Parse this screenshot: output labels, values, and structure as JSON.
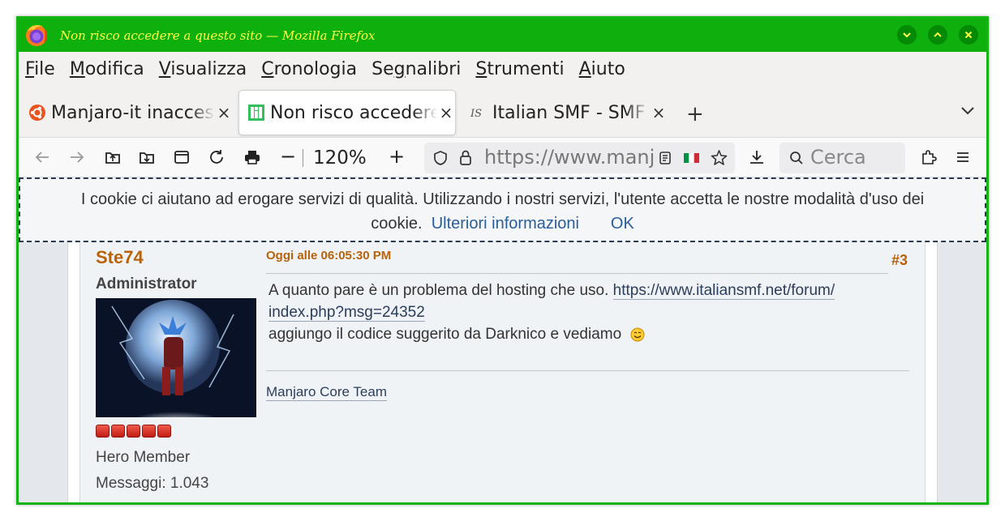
{
  "window": {
    "title": "Non risco accedere a questo sito — Mozilla Firefox",
    "border_color": "#14b414",
    "titlebar_color": "#0db00d",
    "title_color": "#ffff44"
  },
  "menu": [
    {
      "prefix": "",
      "mnemonic": "F",
      "rest": "ile"
    },
    {
      "prefix": "",
      "mnemonic": "M",
      "rest": "odifica"
    },
    {
      "prefix": "",
      "mnemonic": "V",
      "rest": "isualizza"
    },
    {
      "prefix": "",
      "mnemonic": "C",
      "rest": "ronologia"
    },
    {
      "prefix": "Se",
      "mnemonic": "g",
      "rest": "nalibri"
    },
    {
      "prefix": "",
      "mnemonic": "S",
      "rest": "trumenti"
    },
    {
      "prefix": "",
      "mnemonic": "A",
      "rest": "iuto"
    }
  ],
  "tabs": [
    {
      "title": "Manjaro-it inaccessibile",
      "icon": "ubuntu-icon",
      "active": false
    },
    {
      "title": "Non risco accedere a questo sito",
      "icon": "manjaro-icon",
      "active": true
    },
    {
      "title": "Italian SMF - SMF",
      "icon": "ismf-icon",
      "active": false
    }
  ],
  "tab_close_glyph": "×",
  "new_tab_glyph": "+",
  "navbar": {
    "zoom_minus": "−",
    "zoom_level": "120%",
    "zoom_plus": "+",
    "url": "https://www.manjaro.it",
    "search_placeholder": "Cerca"
  },
  "cookie_banner": {
    "text_line1": "I cookie ci aiutano ad erogare servizi di qualità. Utilizzando i nostri servizi, l'utente accetta le nostre modalità d'uso dei",
    "text_line2": "cookie.",
    "more_info": "Ulteriori informazioni",
    "ok": "OK"
  },
  "post": {
    "author": "Ste74",
    "role": "Administrator",
    "star_count": 5,
    "member_group": "Hero Member",
    "post_count": "Messaggi: 1.043",
    "date": "Oggi alle 06:05:30 PM",
    "number": "#3",
    "body_text1": "A quanto pare è un problema del hosting che uso.",
    "link_part1": "https://www.italiansmf.net/forum/",
    "link_part2": "index.php?msg=24352",
    "body_text2": "aggiungo il codice suggerito da Darknico e vediamo",
    "signature": "Manjaro Core Team"
  }
}
